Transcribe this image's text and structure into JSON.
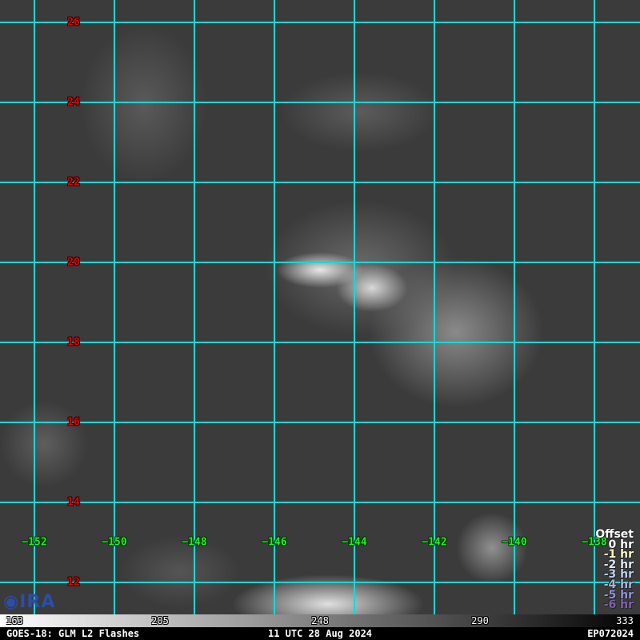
{
  "map": {
    "latitudes": [
      "26",
      "24",
      "22",
      "20",
      "18",
      "16",
      "14",
      "12"
    ],
    "longitudes": [
      "−152",
      "−150",
      "−148",
      "−146",
      "−144",
      "−142",
      "−140",
      "−138"
    ],
    "grid_color": "#19d8d8"
  },
  "legend": {
    "title": "Offset",
    "items": [
      {
        "label": "0 hr",
        "color": "#ffffff"
      },
      {
        "label": "-1 hr",
        "color": "#fff8c8"
      },
      {
        "label": "-2 hr",
        "color": "#dce8f0"
      },
      {
        "label": "-3 hr",
        "color": "#b8d0e8"
      },
      {
        "label": "-4 hr",
        "color": "#a0b8e0"
      },
      {
        "label": "-5 hr",
        "color": "#9090d8"
      },
      {
        "label": "-6 hr",
        "color": "#8060b0"
      }
    ]
  },
  "colorbar": {
    "ticks": [
      "163",
      "205",
      "248",
      "290",
      "333"
    ]
  },
  "footer": {
    "left": "GOES-18: GLM L2 Flashes",
    "center": "11 UTC 28 Aug 2024",
    "right": "EP072024"
  },
  "logo": {
    "text": "CIRA"
  }
}
